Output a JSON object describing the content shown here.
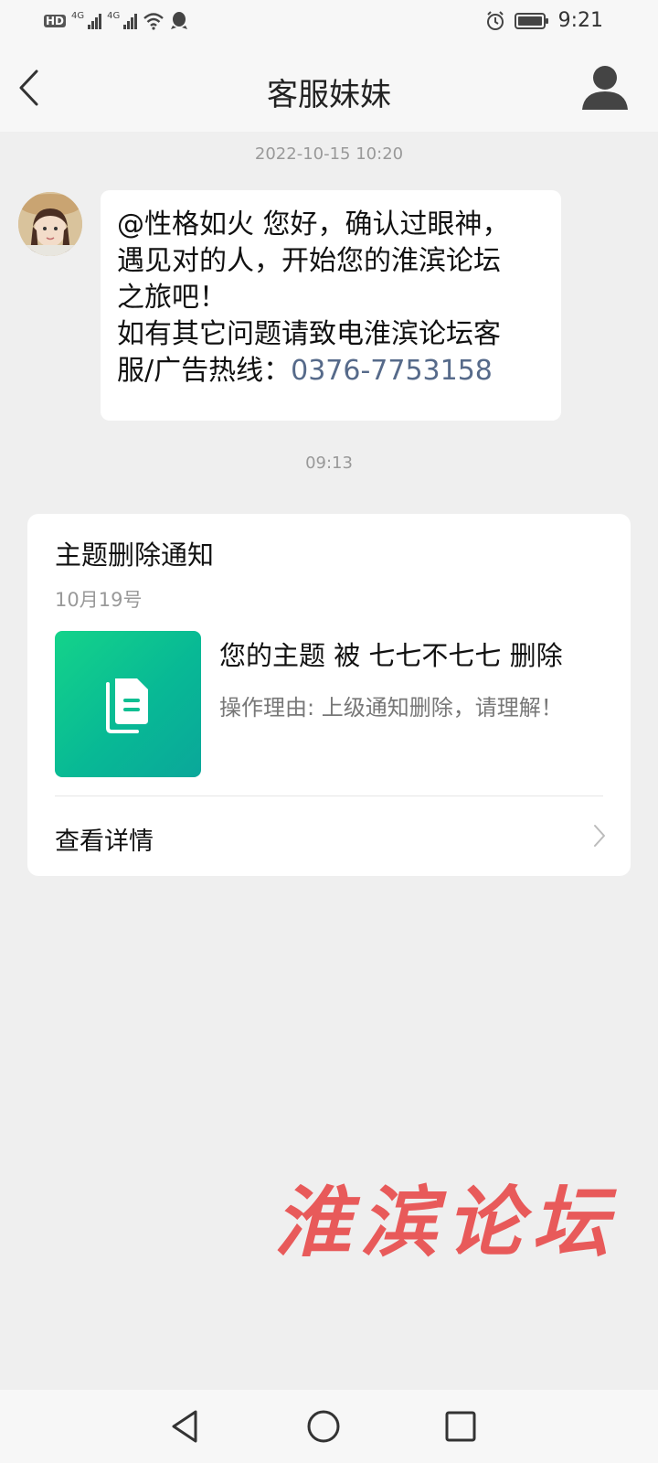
{
  "status_bar": {
    "hd_badge": "HD",
    "network_1": "4G",
    "network_2": "4G",
    "time": "9:21",
    "icons": [
      "hd-icon",
      "signal-icon",
      "signal-icon",
      "wifi-icon",
      "qq-icon",
      "alarm-icon",
      "battery-icon"
    ]
  },
  "header": {
    "title": "客服妹妹",
    "back_icon": "chevron-left-icon",
    "profile_icon": "person-icon"
  },
  "chat": {
    "timestamp_1": "2022-10-15 10:20",
    "message_lines": [
      "@性格如火 您好，确认过眼神，",
      "遇见对的人，开始您的淮滨论坛",
      "之旅吧！",
      "如有其它问题请致电淮滨论坛客"
    ],
    "message_last_prefix": "服/广告热线：",
    "phone": "0376-7753158",
    "timestamp_2": "09:13"
  },
  "notice_card": {
    "title": "主题删除通知",
    "date": "10月19号",
    "thumb_icon": "document-icon",
    "message": "您的主题 被 七七不七七 删除",
    "reason": "操作理由: 上级通知删除，请理解！",
    "detail_label": "查看详情",
    "detail_icon": "chevron-right-icon"
  },
  "watermark": "淮滨论坛",
  "colors": {
    "background": "#efefef",
    "bubble": "#ffffff",
    "link": "#566a8a",
    "thumb_gradient": [
      "#14d38a",
      "#0aa79a"
    ],
    "watermark": "#e85a5a"
  },
  "bottom_nav": {
    "icons": [
      "back-triangle-icon",
      "home-circle-icon",
      "recents-square-icon"
    ]
  }
}
